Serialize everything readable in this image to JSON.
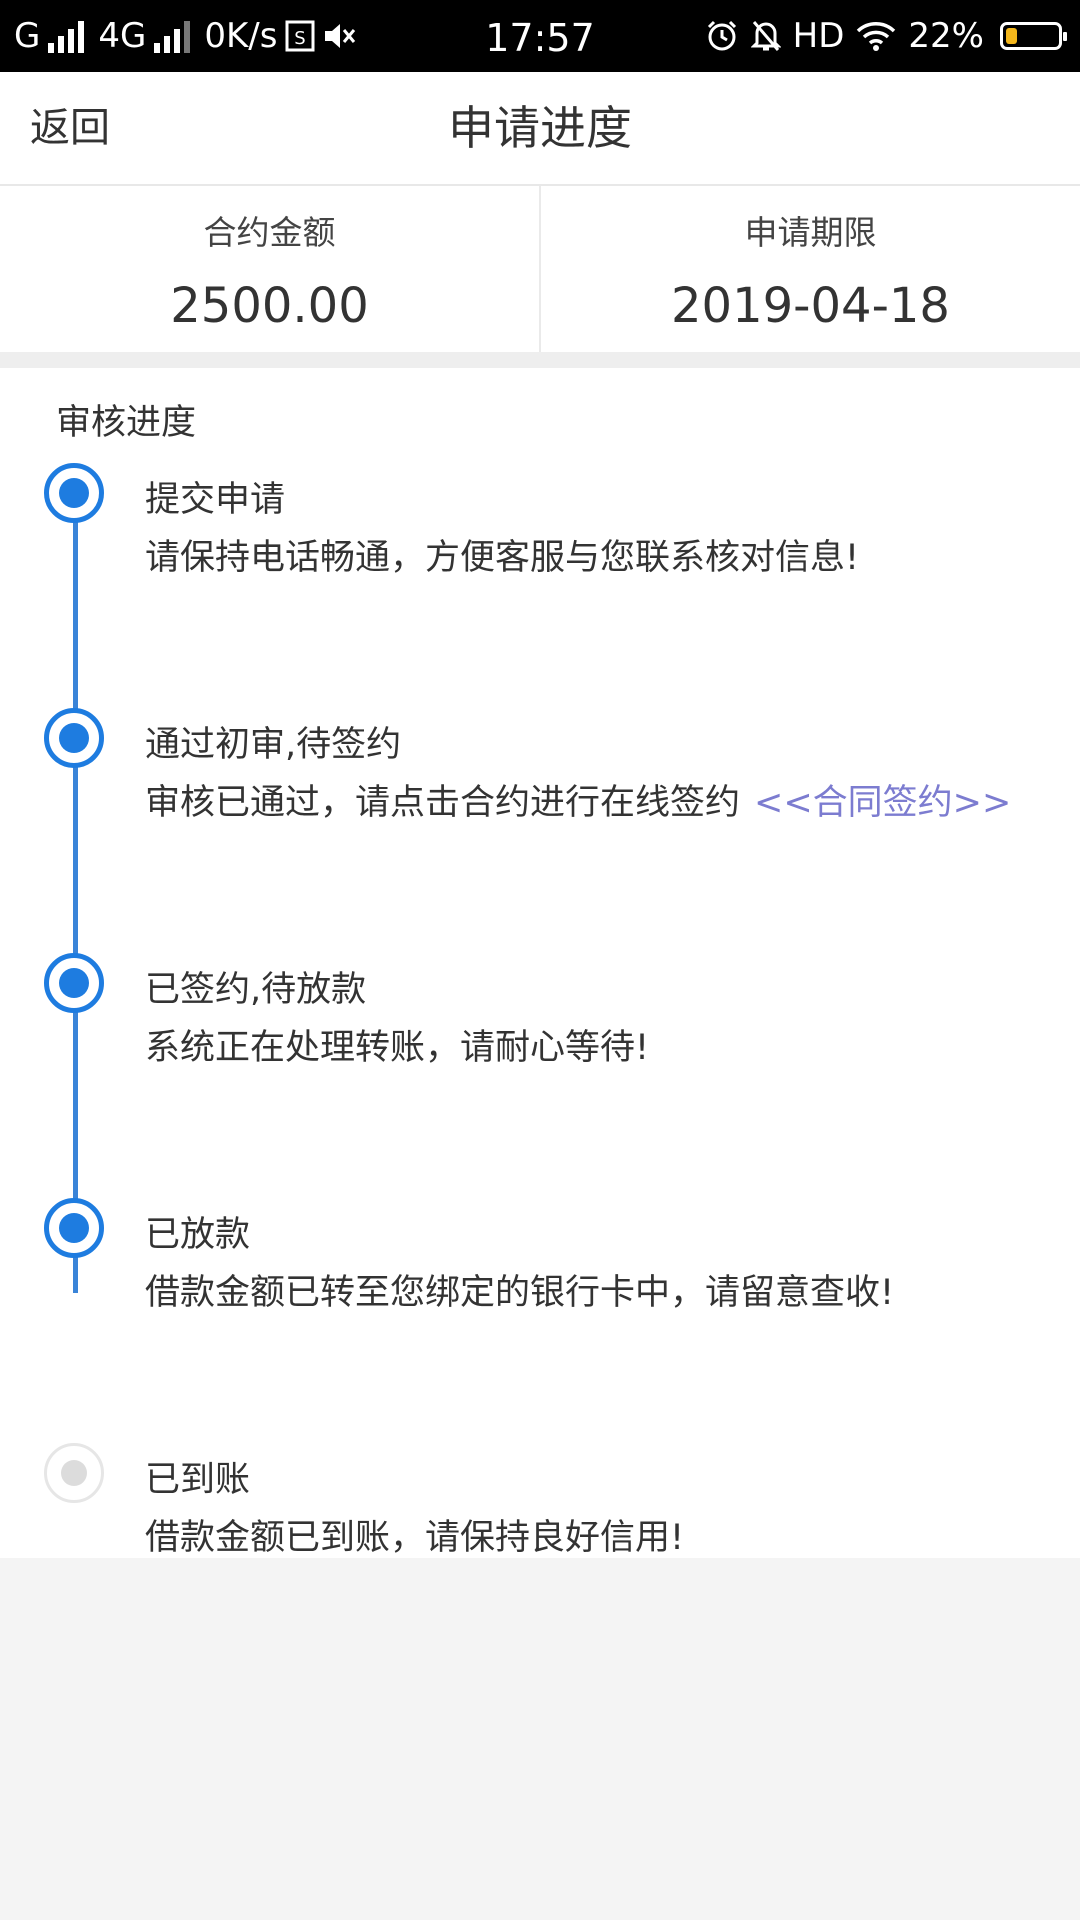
{
  "status_bar": {
    "carrier_g": "G",
    "network": "4G",
    "speed": "0K/s",
    "time": "17:57",
    "hd": "HD",
    "battery": "22%",
    "battery_level": 0.22
  },
  "nav": {
    "back": "返回",
    "title": "申请进度"
  },
  "summary": {
    "amount_label": "合约金额",
    "amount_value": "2500.00",
    "term_label": "申请期限",
    "term_value": "2019-04-18"
  },
  "progress": {
    "heading": "审核进度",
    "steps": [
      {
        "title": "提交申请",
        "desc": "请保持电话畅通，方便客服与您联系核对信息!",
        "done": true
      },
      {
        "title": "通过初审,待签约",
        "desc": "审核已通过，请点击合约进行在线签约",
        "link": "<<合同签约>>",
        "done": true
      },
      {
        "title": "已签约,待放款",
        "desc": "系统正在处理转账，请耐心等待!",
        "done": true
      },
      {
        "title": "已放款",
        "desc": "借款金额已转至您绑定的银行卡中，请留意查收!",
        "done": true
      },
      {
        "title": "已到账",
        "desc": "借款金额已到账，请保持良好信用!",
        "done": false
      }
    ]
  },
  "colors": {
    "accent": "#1e7ce0",
    "timeline": "#3a84d8",
    "link": "#7c7cd0"
  }
}
